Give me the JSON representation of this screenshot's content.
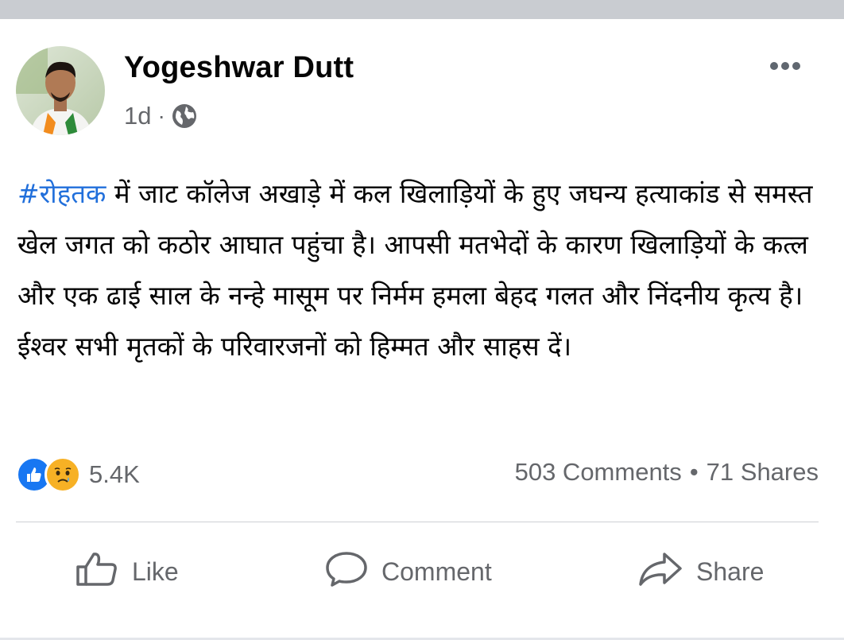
{
  "post": {
    "author": "Yogeshwar Dutt",
    "time": "1d",
    "separator": "·",
    "audience_icon": "globe-icon",
    "more_icon": "more-dots-icon",
    "hashtag": "#रोहतक",
    "text_after_hashtag": " में जाट कॉलेज अखाड़े में कल खिलाड़ियों के हुए जघन्य हत्याकांड से समस्त खेल जगत को कठोर आघात पहुंचा है। आपसी मतभेदों के कारण खिलाड़ियों के कत्ल और एक ढाई साल के नन्हे मासूम पर निर्मम हमला बेहद गलत और निंदनीय कृत्य है। ईश्वर सभी मृतकों के परिवारजनों को हिम्मत और साहस दें।"
  },
  "engagement": {
    "reaction_icons": [
      "like-reaction-icon",
      "sad-reaction-icon"
    ],
    "reaction_count": "5.4K",
    "comments": "503 Comments",
    "dot": "•",
    "shares": "71 Shares"
  },
  "actions": {
    "like": "Like",
    "comment": "Comment",
    "share": "Share"
  },
  "colors": {
    "hashtag": "#216fdb",
    "like_blue": "#1877f2",
    "sad_yellow": "#f7b125",
    "secondary_text": "#65676b",
    "divider": "#c9ccd1"
  }
}
